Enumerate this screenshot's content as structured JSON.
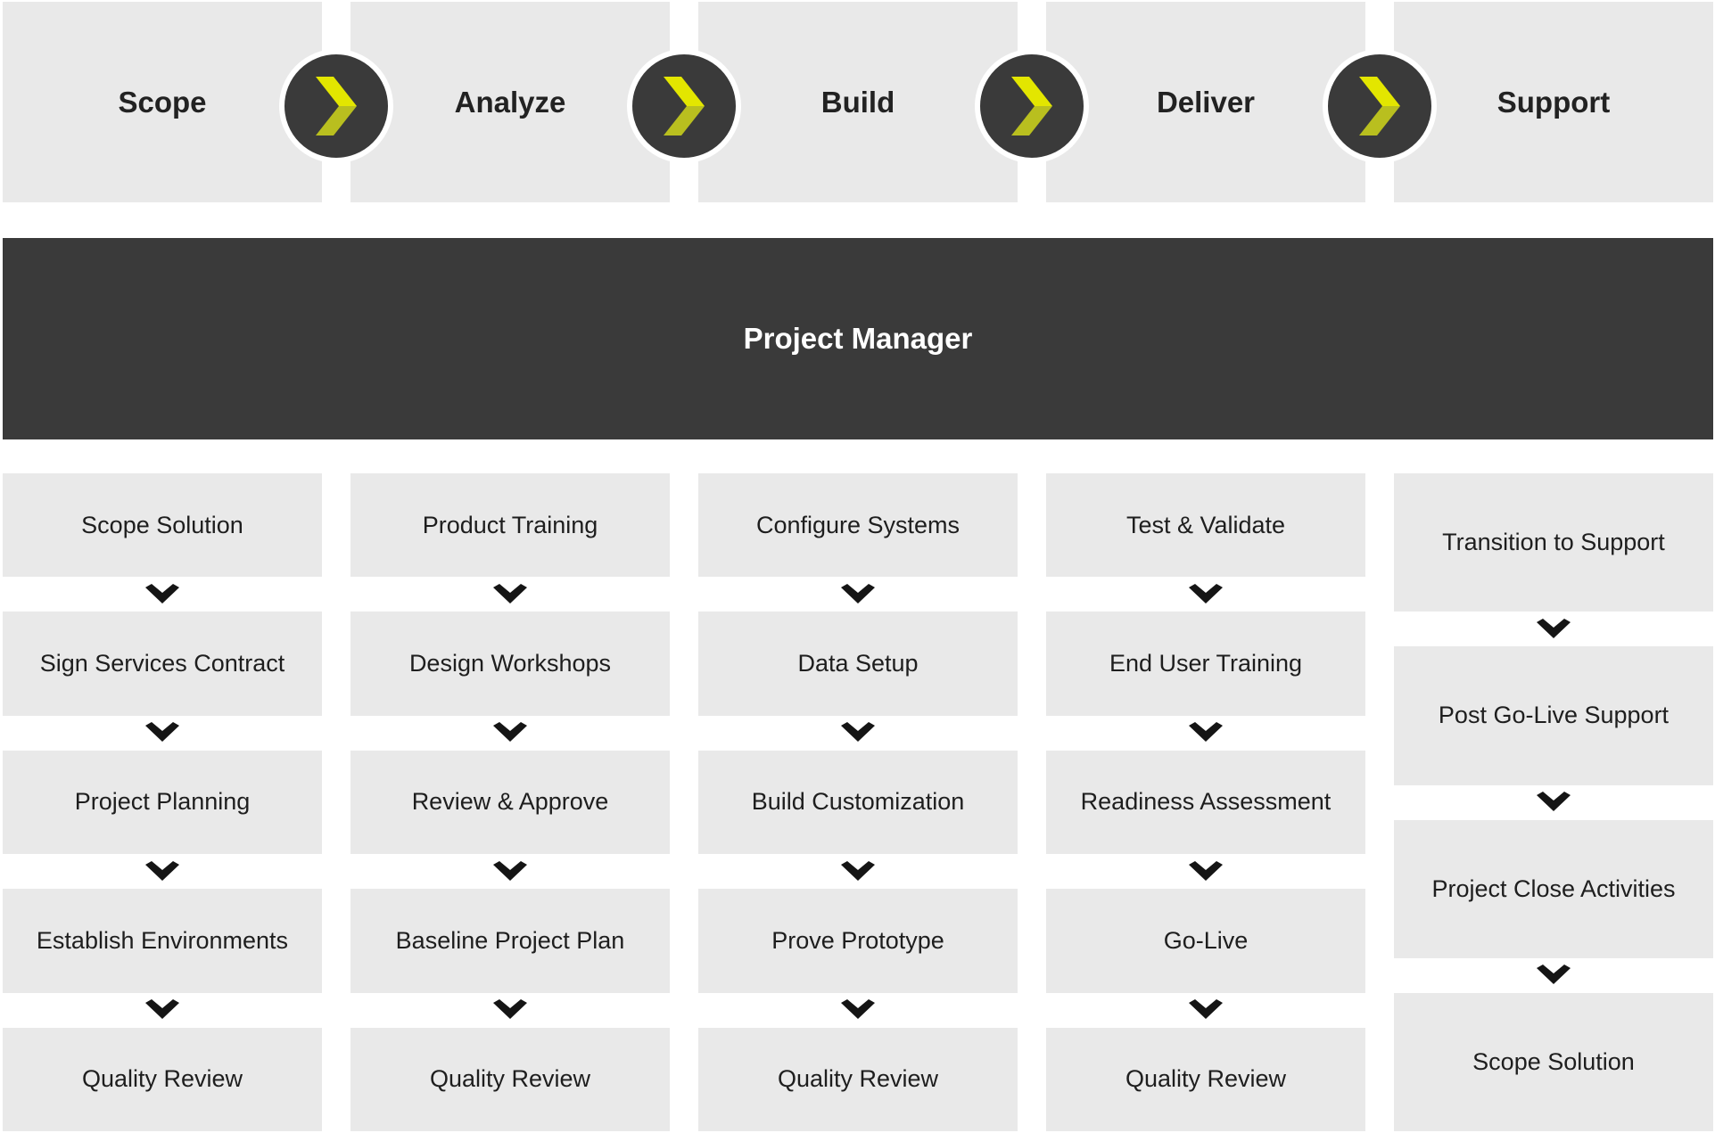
{
  "phases": [
    "Scope",
    "Analyze",
    "Build",
    "Deliver",
    "Support"
  ],
  "manager": "Project Manager",
  "columns": [
    [
      "Scope Solution",
      "Sign Services Contract",
      "Project Planning",
      "Establish Environments",
      "Quality Review"
    ],
    [
      "Product Training",
      "Design Workshops",
      "Review & Approve",
      "Baseline Project Plan",
      "Quality Review"
    ],
    [
      "Configure Systems",
      "Data Setup",
      "Build Customization",
      "Prove Prototype",
      "Quality Review"
    ],
    [
      "Test & Validate",
      "End User Training",
      "Readiness Assessment",
      "Go-Live",
      "Quality Review"
    ],
    [
      "Transition to Support",
      "Post Go-Live Support",
      "Project Close Activities",
      "Scope Solution"
    ]
  ],
  "colors": {
    "box": "#e9e9e9",
    "dark": "#3a3a3a",
    "accent": "#e3e600",
    "accent_shade": "#b9bf1f"
  },
  "icons": {
    "phase_arrow": "chevron-right-icon",
    "step_arrow": "chevron-down-icon"
  }
}
